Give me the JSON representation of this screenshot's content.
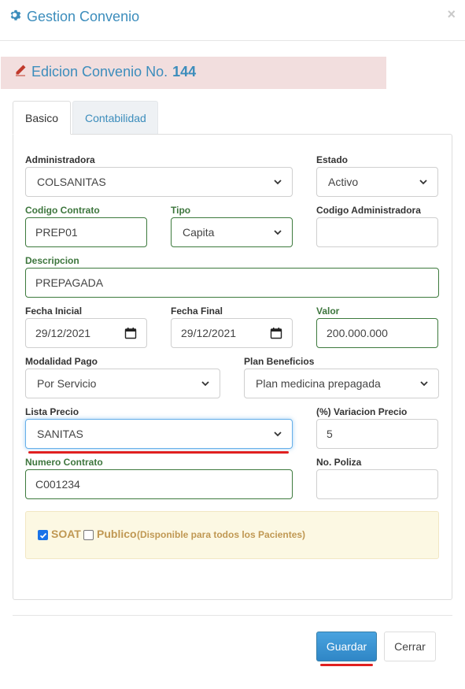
{
  "header": {
    "title": "Gestion Convenio",
    "close": "×"
  },
  "edition": {
    "prefix": "Edicion Convenio No.",
    "number": "144"
  },
  "tabs": [
    {
      "label": "Basico"
    },
    {
      "label": "Contabilidad"
    }
  ],
  "form": {
    "administradora": {
      "label": "Administradora",
      "value": "COLSANITAS"
    },
    "estado": {
      "label": "Estado",
      "value": "Activo"
    },
    "codigo_contrato": {
      "label": "Codigo Contrato",
      "value": "PREP01"
    },
    "tipo": {
      "label": "Tipo",
      "value": "Capita"
    },
    "codigo_administradora": {
      "label": "Codigo Administradora",
      "value": ""
    },
    "descripcion": {
      "label": "Descripcion",
      "value": "PREPAGADA"
    },
    "fecha_inicial": {
      "label": "Fecha Inicial",
      "value": "29/12/2021"
    },
    "fecha_final": {
      "label": "Fecha Final",
      "value": "29/12/2021"
    },
    "valor": {
      "label": "Valor",
      "value": "200.000.000"
    },
    "modalidad_pago": {
      "label": "Modalidad Pago",
      "value": "Por Servicio"
    },
    "plan_beneficios": {
      "label": "Plan Beneficios",
      "value": "Plan medicina prepagada"
    },
    "lista_precio": {
      "label": "Lista Precio",
      "value": "SANITAS"
    },
    "variacion_precio": {
      "label": "(%) Variacion Precio",
      "value": "5"
    },
    "numero_contrato": {
      "label": "Numero Contrato",
      "value": "C001234"
    },
    "no_poliza": {
      "label": "No. Poliza",
      "value": ""
    }
  },
  "options": {
    "soat": {
      "label": "SOAT",
      "checked": true
    },
    "publico": {
      "label": "Publico",
      "note": "(Disponible para todos los Pacientes)",
      "checked": false
    }
  },
  "buttons": {
    "guardar": "Guardar",
    "cerrar": "Cerrar"
  },
  "colors": {
    "accent": "#3c8dbc",
    "success": "#3d763d",
    "warning_text": "#c09853",
    "highlight": "#e02020"
  }
}
